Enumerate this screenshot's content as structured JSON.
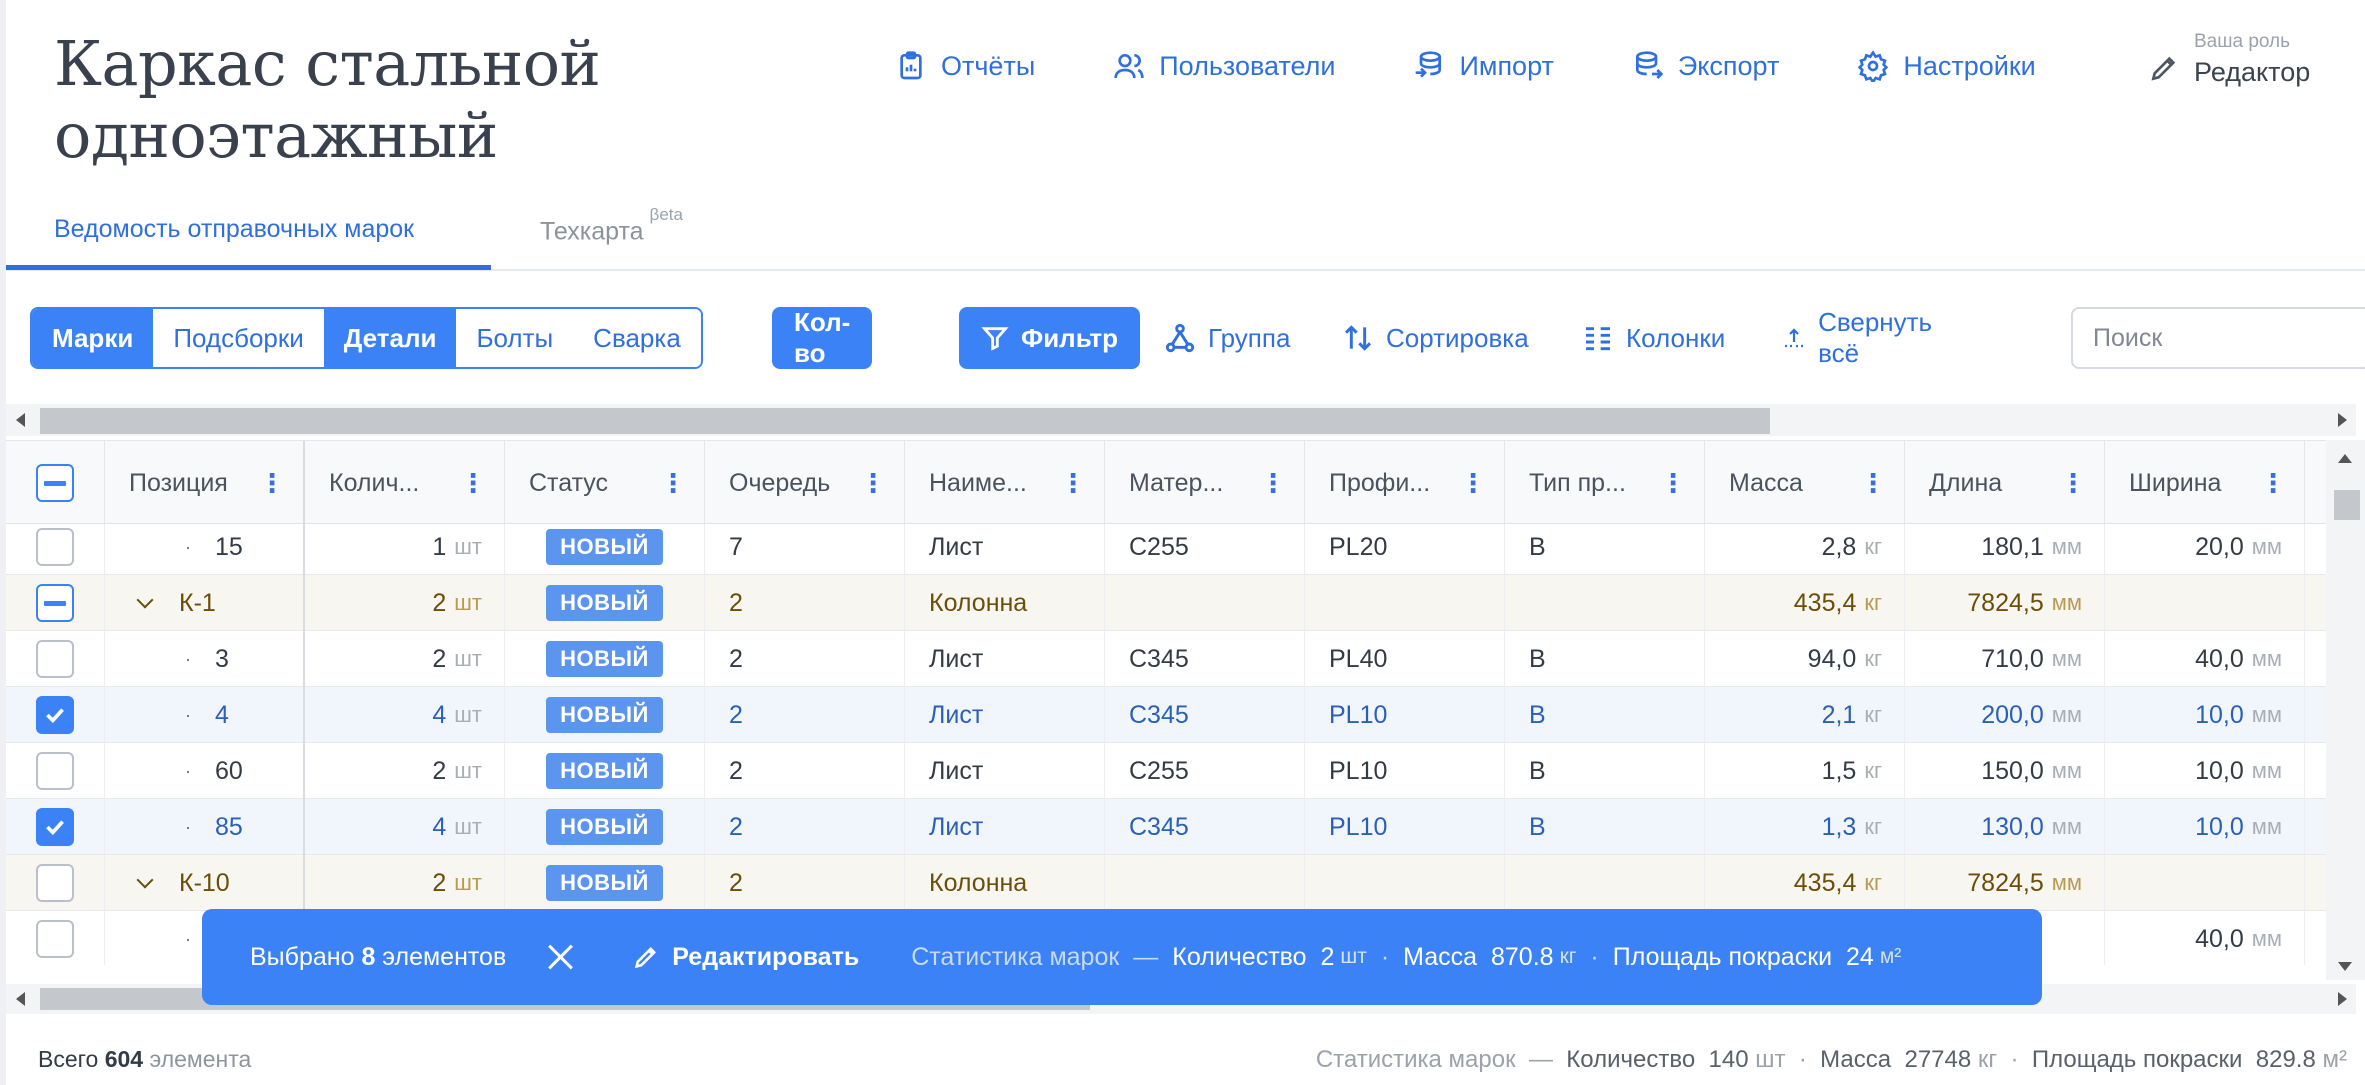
{
  "title_line1": "Каркас стальной",
  "title_line2": "одноэтажный",
  "nav": [
    {
      "label": "Отчёты",
      "icon": "clipboard-icon"
    },
    {
      "label": "Пользователи",
      "icon": "users-icon"
    },
    {
      "label": "Импорт",
      "icon": "database-import-icon"
    },
    {
      "label": "Экспорт",
      "icon": "database-export-icon"
    },
    {
      "label": "Настройки",
      "icon": "gear-icon"
    }
  ],
  "role": {
    "caption": "Ваша роль",
    "value": "Редактор"
  },
  "tabs": {
    "active": "Ведомость отправочных марок",
    "inactive": "Техкарта",
    "inactive_badge": "βeta"
  },
  "toolbar": {
    "segments": [
      {
        "label": "Марки",
        "on": true
      },
      {
        "label": "Подсборки",
        "on": false
      },
      {
        "label": "Детали",
        "on": true
      },
      {
        "label": "Болты",
        "on": false
      },
      {
        "label": "Сварка",
        "on": false
      }
    ],
    "qty": "Кол-во",
    "filter": "Фильтр",
    "group": "Группа",
    "sort": "Сортировка",
    "columns": "Колонки",
    "collapse": "Свернуть всё",
    "search_placeholder": "Поиск"
  },
  "columns": [
    "Позиция",
    "Колич...",
    "Статус",
    "Очередь",
    "Наиме...",
    "Матер...",
    "Профи...",
    "Тип пр...",
    "Масса",
    "Длина",
    "Ширина"
  ],
  "units": {
    "qty": "шт",
    "mass": "кг",
    "length": "мм"
  },
  "rows": [
    {
      "check": "none",
      "kind": "item",
      "pos": "15",
      "qty": "1",
      "status": "НОВЫЙ",
      "queue": "7",
      "name": "Лист",
      "mat": "С255",
      "prof": "PL20",
      "type": "B",
      "mass": "2,8",
      "len": "180,1",
      "width": "20,0"
    },
    {
      "check": "indet",
      "kind": "group",
      "pos": "К-1",
      "qty": "2",
      "status": "НОВЫЙ",
      "queue": "2",
      "name": "Колонна",
      "mat": "",
      "prof": "",
      "type": "",
      "mass": "435,4",
      "len": "7824,5",
      "width": ""
    },
    {
      "check": "none",
      "kind": "item",
      "pos": "3",
      "qty": "2",
      "status": "НОВЫЙ",
      "queue": "2",
      "name": "Лист",
      "mat": "С345",
      "prof": "PL40",
      "type": "B",
      "mass": "94,0",
      "len": "710,0",
      "width": "40,0"
    },
    {
      "check": "checked",
      "kind": "item",
      "pos": "4",
      "qty": "4",
      "status": "НОВЫЙ",
      "queue": "2",
      "name": "Лист",
      "mat": "С345",
      "prof": "PL10",
      "type": "B",
      "mass": "2,1",
      "len": "200,0",
      "width": "10,0"
    },
    {
      "check": "none",
      "kind": "item",
      "pos": "60",
      "qty": "2",
      "status": "НОВЫЙ",
      "queue": "2",
      "name": "Лист",
      "mat": "С255",
      "prof": "PL10",
      "type": "B",
      "mass": "1,5",
      "len": "150,0",
      "width": "10,0"
    },
    {
      "check": "checked",
      "kind": "item",
      "pos": "85",
      "qty": "4",
      "status": "НОВЫЙ",
      "queue": "2",
      "name": "Лист",
      "mat": "С345",
      "prof": "PL10",
      "type": "B",
      "mass": "1,3",
      "len": "130,0",
      "width": "10,0"
    },
    {
      "check": "none",
      "kind": "group",
      "pos": "К-10",
      "qty": "2",
      "status": "НОВЫЙ",
      "queue": "2",
      "name": "Колонна",
      "mat": "",
      "prof": "",
      "type": "",
      "mass": "435,4",
      "len": "7824,5",
      "width": ""
    },
    {
      "check": "none",
      "kind": "item",
      "pos": "",
      "qty": "",
      "status": "",
      "queue": "",
      "name": "",
      "mat": "",
      "prof": "",
      "type": "",
      "mass": "",
      "len": "",
      "width": "40,0"
    }
  ],
  "selection": {
    "prefix": "Выбрано",
    "count": "8",
    "suffix": "элементов",
    "edit": "Редактировать",
    "stats_label": "Статистика марок",
    "qty_label": "Количество",
    "qty_value": "2",
    "mass_label": "Масса",
    "mass_value": "870.8",
    "area_label": "Площадь покраски",
    "area_value": "24",
    "area_unit": "м²"
  },
  "footer": {
    "total_label": "Всего",
    "total_value": "604",
    "total_unit": "элемента",
    "stats_label": "Статистика марок",
    "qty_label": "Количество",
    "qty_value": "140",
    "mass_label": "Масса",
    "mass_value": "27748",
    "area_label": "Площадь покраски",
    "area_value": "829.8",
    "area_unit": "м²"
  }
}
